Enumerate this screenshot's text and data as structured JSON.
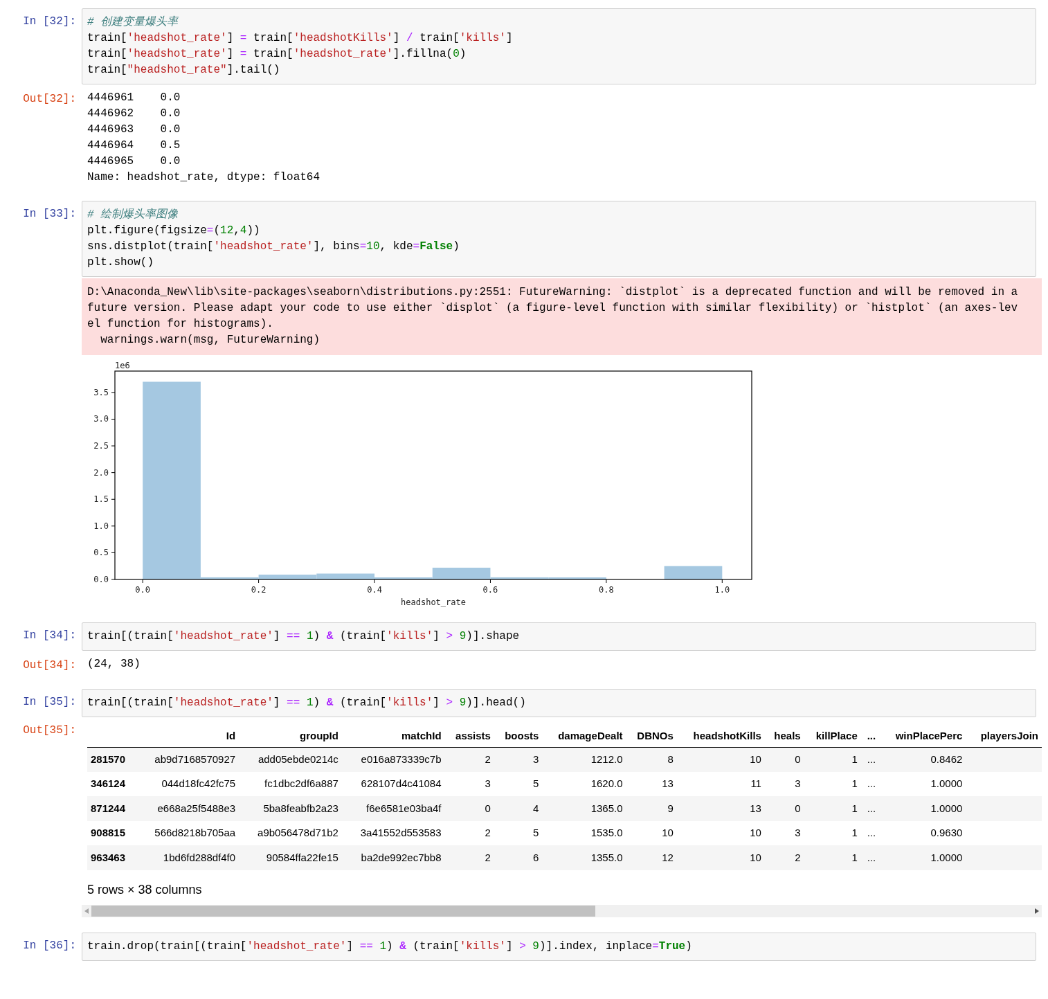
{
  "cells": [
    {
      "prompt": "In [32]:",
      "code": [
        [
          {
            "kind": "comment",
            "text": "# 创建变量爆头率"
          }
        ],
        [
          {
            "kind": "plain",
            "text": "train["
          },
          {
            "kind": "string",
            "text": "'headshot_rate'"
          },
          {
            "kind": "plain",
            "text": "]"
          },
          {
            "kind": "op",
            "text": " = "
          },
          {
            "kind": "plain",
            "text": "train["
          },
          {
            "kind": "string",
            "text": "'headshotKills'"
          },
          {
            "kind": "plain",
            "text": "]"
          },
          {
            "kind": "op",
            "text": " / "
          },
          {
            "kind": "plain",
            "text": "train["
          },
          {
            "kind": "string",
            "text": "'kills'"
          },
          {
            "kind": "plain",
            "text": "]"
          }
        ],
        [
          {
            "kind": "plain",
            "text": "train["
          },
          {
            "kind": "string",
            "text": "'headshot_rate'"
          },
          {
            "kind": "plain",
            "text": "]"
          },
          {
            "kind": "op",
            "text": " = "
          },
          {
            "kind": "plain",
            "text": "train["
          },
          {
            "kind": "string",
            "text": "'headshot_rate'"
          },
          {
            "kind": "plain",
            "text": "].fillna("
          },
          {
            "kind": "number",
            "text": "0"
          },
          {
            "kind": "plain",
            "text": ")"
          }
        ],
        [
          {
            "kind": "plain",
            "text": "train["
          },
          {
            "kind": "string",
            "text": "\"headshot_rate\""
          },
          {
            "kind": "plain",
            "text": "].tail()"
          }
        ]
      ],
      "outputs": [
        {
          "kind": "text",
          "prompt": "Out[32]:",
          "lines": [
            "4446961    0.0",
            "4446962    0.0",
            "4446963    0.0",
            "4446964    0.5",
            "4446965    0.0",
            "Name: headshot_rate, dtype: float64"
          ]
        }
      ]
    },
    {
      "prompt": "In [33]:",
      "code": [
        [
          {
            "kind": "comment",
            "text": "# 绘制爆头率图像"
          }
        ],
        [
          {
            "kind": "plain",
            "text": "plt.figure(figsize"
          },
          {
            "kind": "op",
            "text": "="
          },
          {
            "kind": "plain",
            "text": "("
          },
          {
            "kind": "number",
            "text": "12"
          },
          {
            "kind": "plain",
            "text": ","
          },
          {
            "kind": "number",
            "text": "4"
          },
          {
            "kind": "plain",
            "text": "))"
          }
        ],
        [
          {
            "kind": "plain",
            "text": "sns.distplot(train["
          },
          {
            "kind": "string",
            "text": "'headshot_rate'"
          },
          {
            "kind": "plain",
            "text": "], bins"
          },
          {
            "kind": "op",
            "text": "="
          },
          {
            "kind": "number",
            "text": "10"
          },
          {
            "kind": "plain",
            "text": ", kde"
          },
          {
            "kind": "op",
            "text": "="
          },
          {
            "kind": "keyword",
            "text": "False"
          },
          {
            "kind": "plain",
            "text": ")"
          }
        ],
        [
          {
            "kind": "plain",
            "text": "plt.show()"
          }
        ]
      ],
      "outputs": [
        {
          "kind": "stderr",
          "lines": [
            "D:\\Anaconda_New\\lib\\site-packages\\seaborn\\distributions.py:2551: FutureWarning: `distplot` is a deprecated function and will be removed in a",
            "future version. Please adapt your code to use either `displot` (a figure-level function with similar flexibility) or `histplot` (an axes-lev",
            "el function for histograms).",
            "  warnings.warn(msg, FutureWarning)"
          ]
        },
        {
          "kind": "chart",
          "chart_data": {
            "type": "bar",
            "xlabel": "headshot_rate",
            "x": [
              0.05,
              0.15,
              0.25,
              0.35,
              0.45,
              0.55,
              0.65,
              0.75,
              0.85,
              0.95
            ],
            "values": [
              3.7,
              0.04,
              0.09,
              0.11,
              0.02,
              0.22,
              0.04,
              0.02,
              0,
              0.25
            ],
            "xlim": [
              -0.048,
              1.051
            ],
            "ylim": [
              0,
              3.9
            ],
            "xticks": [
              {
                "value": 0,
                "label": "0.0"
              },
              {
                "value": 0.2,
                "label": "0.2"
              },
              {
                "value": 0.4,
                "label": "0.4"
              },
              {
                "value": 0.6,
                "label": "0.6"
              },
              {
                "value": 0.8,
                "label": "0.8"
              },
              {
                "value": 1,
                "label": "1.0"
              }
            ],
            "yticks": [
              {
                "value": 0,
                "label": "0.0"
              },
              {
                "value": 0.5,
                "label": "0.5"
              },
              {
                "value": 1,
                "label": "1.0"
              },
              {
                "value": 1.5,
                "label": "1.5"
              },
              {
                "value": 2,
                "label": "2.0"
              },
              {
                "value": 2.5,
                "label": "2.5"
              },
              {
                "value": 3,
                "label": "3.0"
              },
              {
                "value": 3.5,
                "label": "3.5"
              }
            ],
            "annotations": [
              {
                "text": "1e6"
              }
            ]
          }
        }
      ]
    },
    {
      "prompt": "In [34]:",
      "code": [
        [
          {
            "kind": "plain",
            "text": "train[(train["
          },
          {
            "kind": "string",
            "text": "'headshot_rate'"
          },
          {
            "kind": "plain",
            "text": "]"
          },
          {
            "kind": "op",
            "text": " == "
          },
          {
            "kind": "number",
            "text": "1"
          },
          {
            "kind": "plain",
            "text": ") "
          },
          {
            "kind": "bold_op",
            "text": "&"
          },
          {
            "kind": "plain",
            "text": " (train["
          },
          {
            "kind": "string",
            "text": "'kills'"
          },
          {
            "kind": "plain",
            "text": "]"
          },
          {
            "kind": "op",
            "text": " > "
          },
          {
            "kind": "number",
            "text": "9"
          },
          {
            "kind": "plain",
            "text": ")].shape"
          }
        ]
      ],
      "outputs": [
        {
          "kind": "text",
          "prompt": "Out[34]:",
          "lines": [
            "(24, 38)"
          ]
        }
      ]
    },
    {
      "prompt": "In [35]:",
      "code": [
        [
          {
            "kind": "plain",
            "text": "train[(train["
          },
          {
            "kind": "string",
            "text": "'headshot_rate'"
          },
          {
            "kind": "plain",
            "text": "]"
          },
          {
            "kind": "op",
            "text": " == "
          },
          {
            "kind": "number",
            "text": "1"
          },
          {
            "kind": "plain",
            "text": ") "
          },
          {
            "kind": "bold_op",
            "text": "&"
          },
          {
            "kind": "plain",
            "text": " (train["
          },
          {
            "kind": "string",
            "text": "'kills'"
          },
          {
            "kind": "plain",
            "text": "]"
          },
          {
            "kind": "op",
            "text": " > "
          },
          {
            "kind": "number",
            "text": "9"
          },
          {
            "kind": "plain",
            "text": ")].head()"
          }
        ]
      ],
      "outputs": [
        {
          "kind": "table",
          "prompt": "Out[35]:",
          "columns": [
            "Id",
            "groupId",
            "matchId",
            "assists",
            "boosts",
            "damageDealt",
            "DBNOs",
            "headshotKills",
            "heals",
            "killPlace",
            "...",
            "winPlacePerc",
            "playersJoin"
          ],
          "rows": [
            {
              "index": "281570",
              "cells": [
                "ab9d7168570927",
                "add05ebde0214c",
                "e016a873339c7b",
                "2",
                "3",
                "1212.0",
                "8",
                "10",
                "0",
                "1",
                "...",
                "0.8462"
              ]
            },
            {
              "index": "346124",
              "cells": [
                "044d18fc42fc75",
                "fc1dbc2df6a887",
                "628107d4c41084",
                "3",
                "5",
                "1620.0",
                "13",
                "11",
                "3",
                "1",
                "...",
                "1.0000"
              ]
            },
            {
              "index": "871244",
              "cells": [
                "e668a25f5488e3",
                "5ba8feabfb2a23",
                "f6e6581e03ba4f",
                "0",
                "4",
                "1365.0",
                "9",
                "13",
                "0",
                "1",
                "...",
                "1.0000"
              ]
            },
            {
              "index": "908815",
              "cells": [
                "566d8218b705aa",
                "a9b056478d71b2",
                "3a41552d553583",
                "2",
                "5",
                "1535.0",
                "10",
                "10",
                "3",
                "1",
                "...",
                "0.9630"
              ]
            },
            {
              "index": "963463",
              "cells": [
                "1bd6fd288df4f0",
                "90584ffa22fe15",
                "ba2de992ec7bb8",
                "2",
                "6",
                "1355.0",
                "12",
                "10",
                "2",
                "1",
                "...",
                "1.0000"
              ]
            }
          ],
          "footer": "5 rows × 38 columns"
        }
      ]
    },
    {
      "prompt": "In [36]:",
      "code": [
        [
          {
            "kind": "plain",
            "text": "train.drop(train[(train["
          },
          {
            "kind": "string",
            "text": "'headshot_rate'"
          },
          {
            "kind": "plain",
            "text": "]"
          },
          {
            "kind": "op",
            "text": " == "
          },
          {
            "kind": "number",
            "text": "1"
          },
          {
            "kind": "plain",
            "text": ") "
          },
          {
            "kind": "bold_op",
            "text": "&"
          },
          {
            "kind": "plain",
            "text": " (train["
          },
          {
            "kind": "string",
            "text": "'kills'"
          },
          {
            "kind": "plain",
            "text": "]"
          },
          {
            "kind": "op",
            "text": " > "
          },
          {
            "kind": "number",
            "text": "9"
          },
          {
            "kind": "plain",
            "text": ")].index, inplace"
          },
          {
            "kind": "op",
            "text": "="
          },
          {
            "kind": "keyword",
            "text": "True"
          },
          {
            "kind": "plain",
            "text": ")"
          }
        ]
      ]
    }
  ]
}
